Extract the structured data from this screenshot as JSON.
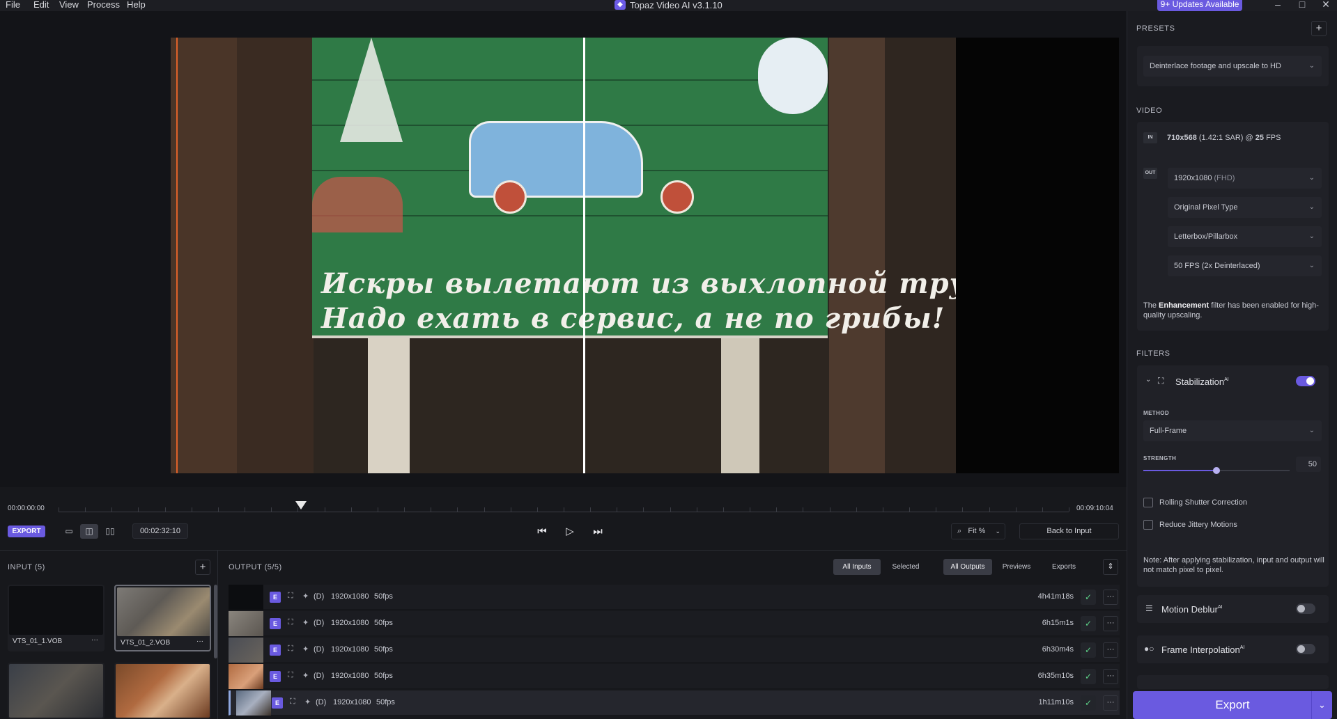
{
  "menu": {
    "file": "File",
    "edit": "Edit",
    "view": "View",
    "process": "Process",
    "help": "Help"
  },
  "title": "Topaz Video AI  v3.1.10",
  "updates_label": "9+ Updates Available",
  "video_sign": {
    "line1": "Искры вылетают из выхлопной трубы-",
    "line2": "Надо ехать в сервис, а не по грибы!"
  },
  "timeline": {
    "start": "00:00:00:00",
    "end": "00:09:10:04",
    "playhead_position": 0.24
  },
  "controls": {
    "export_badge": "EXPORT",
    "timecode": "00:02:32:10",
    "zoom": "Fit %",
    "back_to_input": "Back to Input"
  },
  "input": {
    "title": "INPUT (5)",
    "files": [
      {
        "name": "VTS_01_1.VOB",
        "more": "···"
      },
      {
        "name": "VTS_01_2.VOB",
        "more": "···"
      },
      {
        "name": "",
        "more": ""
      },
      {
        "name": "",
        "more": ""
      }
    ]
  },
  "output": {
    "title": "OUTPUT (5/5)",
    "filters": [
      "All Inputs",
      "Selected"
    ],
    "views": [
      "All Outputs",
      "Previews",
      "Exports"
    ],
    "rows": [
      {
        "badge": "E",
        "mode": "(D)",
        "res": "1920x1080",
        "fps": "50fps",
        "duration": "4h41m18s"
      },
      {
        "badge": "E",
        "mode": "(D)",
        "res": "1920x1080",
        "fps": "50fps",
        "duration": "6h15m1s"
      },
      {
        "badge": "E",
        "mode": "(D)",
        "res": "1920x1080",
        "fps": "50fps",
        "duration": "6h30m4s"
      },
      {
        "badge": "E",
        "mode": "(D)",
        "res": "1920x1080",
        "fps": "50fps",
        "duration": "6h35m10s"
      },
      {
        "badge": "E",
        "mode": "(D)",
        "res": "1920x1080",
        "fps": "50fps",
        "duration": "1h11m10s"
      }
    ]
  },
  "sidebar": {
    "presets_title": "PRESETS",
    "preset_value": "Deinterlace footage and upscale to HD",
    "video_title": "VIDEO",
    "in_tag": "IN",
    "out_tag": "OUT",
    "input_res": "710x568",
    "input_sar": "(1.42:1 SAR) @",
    "input_fps": "25",
    "input_fps_unit": "FPS",
    "out_res": "1920x1080",
    "out_res_tag": "(FHD)",
    "pixel_type": "Original Pixel Type",
    "crop_mode": "Letterbox/Pillarbox",
    "fps_mode": "50 FPS (2x Deinterlaced)",
    "note_pre": "The",
    "note_bold": "Enhancement",
    "note_post": "filter has been enabled for high-quality upscaling.",
    "filters_title": "FILTERS",
    "stab_name": "Stabilization",
    "ai_sup": "AI",
    "method_label": "METHOD",
    "method_value": "Full-Frame",
    "strength_label": "STRENGTH",
    "strength_value": "50",
    "rolling_shutter": "Rolling Shutter Correction",
    "reduce_jitter": "Reduce Jittery Motions",
    "stab_note": "Note: After applying stabilization, input and output will not match pixel to pixel.",
    "motion_deblur": "Motion Deblur",
    "frame_interp": "Frame Interpolation",
    "export_label": "Export"
  },
  "colors": {
    "accent": "#6a5ae0",
    "background": "#17181c",
    "panel": "#1a1b20"
  }
}
